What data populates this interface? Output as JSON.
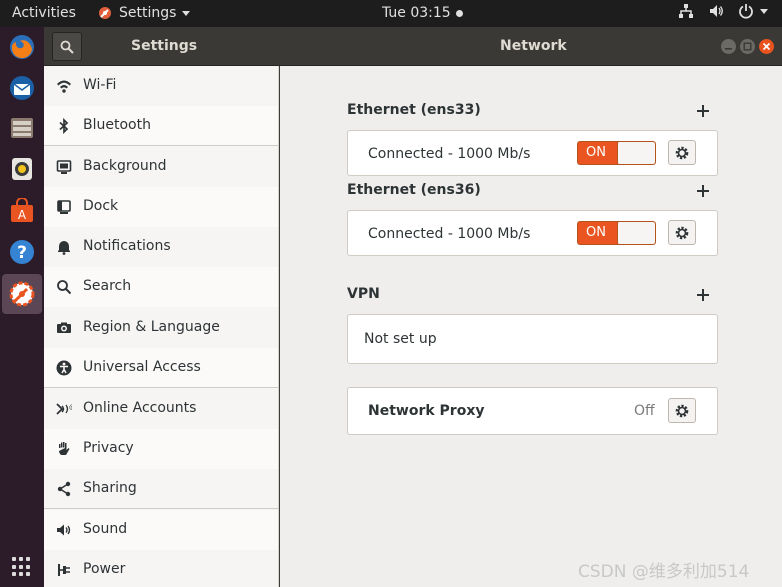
{
  "topbar": {
    "activities": "Activities",
    "app_menu": "Settings",
    "clock": "Tue 03:15"
  },
  "headerbar": {
    "sidebar_title": "Settings",
    "panel_title": "Network"
  },
  "sidebar": {
    "items": [
      {
        "label": "Wi-Fi",
        "icon": "wifi-icon"
      },
      {
        "label": "Bluetooth",
        "icon": "bluetooth-icon"
      },
      {
        "label": "Background",
        "icon": "background-icon"
      },
      {
        "label": "Dock",
        "icon": "dock-icon"
      },
      {
        "label": "Notifications",
        "icon": "bell-icon"
      },
      {
        "label": "Search",
        "icon": "search-icon"
      },
      {
        "label": "Region & Language",
        "icon": "camera-icon"
      },
      {
        "label": "Universal Access",
        "icon": "accessibility-icon"
      },
      {
        "label": "Online Accounts",
        "icon": "online-accounts-icon"
      },
      {
        "label": "Privacy",
        "icon": "hand-icon"
      },
      {
        "label": "Sharing",
        "icon": "share-icon"
      },
      {
        "label": "Sound",
        "icon": "speaker-icon"
      },
      {
        "label": "Power",
        "icon": "power-plug-icon"
      }
    ]
  },
  "network": {
    "eth1": {
      "title": "Ethernet (ens33)",
      "status": "Connected - 1000 Mb/s",
      "switch_label": "ON"
    },
    "eth2": {
      "title": "Ethernet (ens36)",
      "status": "Connected - 1000 Mb/s",
      "switch_label": "ON"
    },
    "vpn": {
      "title": "VPN",
      "status": "Not set up"
    },
    "proxy": {
      "label": "Network Proxy",
      "state": "Off"
    }
  },
  "watermark": "CSDN @维多利加514",
  "colors": {
    "accent": "#e95420",
    "dock": "#2c1b28",
    "topbar": "#1d1d1d"
  }
}
